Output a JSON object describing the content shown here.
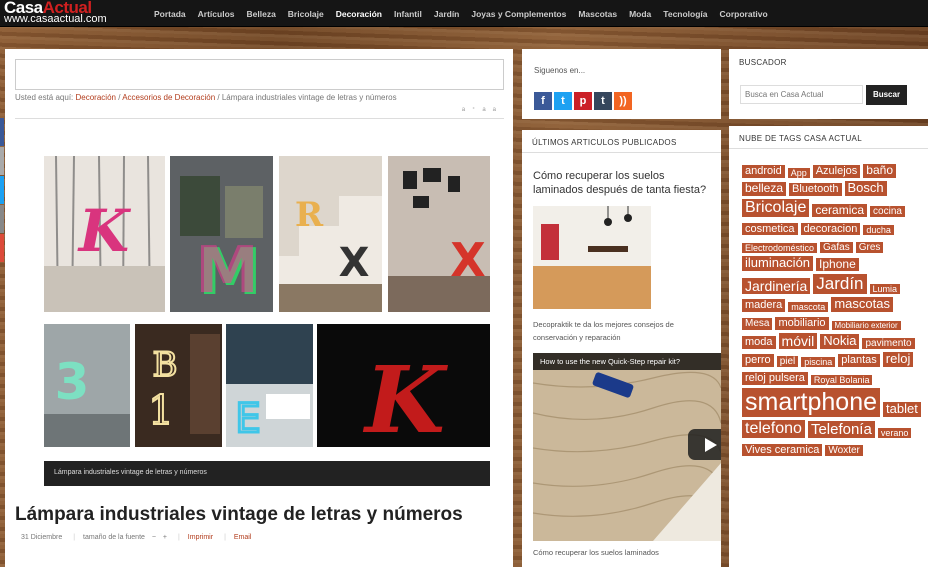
{
  "site": {
    "logo_word1": "Casa",
    "logo_word2": "Actual",
    "logo_domain": "www.casaactual.com"
  },
  "nav": [
    "Portada",
    "Artículos",
    "Belleza",
    "Bricolaje",
    "Decoración",
    "Infantil",
    "Jardín",
    "Joyas y Complementos",
    "Mascotas",
    "Moda",
    "Tecnología",
    "Corporativo"
  ],
  "nav_active": "Decoración",
  "breadcrumb": {
    "prefix": "Usted está aquí:",
    "link1": "Decoración",
    "sep1": " / ",
    "link2": "Accesorios de Decoración",
    "sep2": " / ",
    "current": "Lámpara industriales vintage de letras y números"
  },
  "article": {
    "caption": "Lámpara industriales vintage de letras y números",
    "title": "Lámpara industriales vintage de letras y números",
    "date": "31 Diciembre",
    "font_label": "tamaño de la fuente",
    "font_minus": "−",
    "font_plus": "+",
    "print": "Imprimir",
    "email": "Email"
  },
  "follow": {
    "title": "Siguenos en...",
    "icons": [
      "facebook-icon",
      "twitter-icon",
      "pinterest-icon",
      "tumblr-icon",
      "rss-icon"
    ],
    "colors": [
      "#3b5998",
      "#1da1f2",
      "#cb2027",
      "#35465c",
      "#f26522"
    ]
  },
  "latest": {
    "title": "ÚLTIMOS ARTICULOS PUBLICADOS",
    "post_title": "Cómo recuperar los suelos laminados después de tanta fiesta?",
    "post_desc": "Decopraktik te da los mejores consejos de conservación y reparación",
    "video_title": "How to use the new Quick-Step repair kit?",
    "video_caption": "Cómo recuperar los suelos laminados"
  },
  "search": {
    "title": "BUSCADOR",
    "placeholder": "Busca en Casa Actual",
    "button": "Buscar"
  },
  "tags": {
    "title": "NUBE DE TAGS CASA ACTUAL",
    "items": [
      {
        "t": "android",
        "s": 11
      },
      {
        "t": "App",
        "s": 9
      },
      {
        "t": "Azulejos",
        "s": 11
      },
      {
        "t": "baño",
        "s": 12
      },
      {
        "t": "belleza",
        "s": 12
      },
      {
        "t": "Bluetooth",
        "s": 11
      },
      {
        "t": "Bosch",
        "s": 13
      },
      {
        "t": "Bricolaje",
        "s": 16
      },
      {
        "t": "ceramica",
        "s": 12
      },
      {
        "t": "cocina",
        "s": 10
      },
      {
        "t": "cosmetica",
        "s": 11
      },
      {
        "t": "decoracion",
        "s": 11
      },
      {
        "t": "ducha",
        "s": 9
      },
      {
        "t": "Electrodoméstico",
        "s": 9
      },
      {
        "t": "Gafas",
        "s": 10
      },
      {
        "t": "Gres",
        "s": 10
      },
      {
        "t": "iluminación",
        "s": 13
      },
      {
        "t": "Iphone",
        "s": 12
      },
      {
        "t": "Jardinería",
        "s": 14
      },
      {
        "t": "Jardín",
        "s": 17
      },
      {
        "t": "Lumia",
        "s": 9
      },
      {
        "t": "madera",
        "s": 11
      },
      {
        "t": "mascota",
        "s": 9
      },
      {
        "t": "mascotas",
        "s": 13
      },
      {
        "t": "Mesa",
        "s": 10
      },
      {
        "t": "mobiliario",
        "s": 11
      },
      {
        "t": "Mobiliario exterior",
        "s": 8
      },
      {
        "t": "moda",
        "s": 11
      },
      {
        "t": "móvil",
        "s": 14
      },
      {
        "t": "Nokia",
        "s": 13
      },
      {
        "t": "pavimento",
        "s": 10
      },
      {
        "t": "perro",
        "s": 11
      },
      {
        "t": "piel",
        "s": 10
      },
      {
        "t": "piscina",
        "s": 9
      },
      {
        "t": "plantas",
        "s": 11
      },
      {
        "t": "reloj",
        "s": 13
      },
      {
        "t": "reloj pulsera",
        "s": 11
      },
      {
        "t": "Royal Bolania",
        "s": 9
      },
      {
        "t": "smartphone",
        "s": 25
      },
      {
        "t": "tablet",
        "s": 13
      },
      {
        "t": "telefono",
        "s": 16
      },
      {
        "t": "Telefonía",
        "s": 15
      },
      {
        "t": "verano",
        "s": 9
      },
      {
        "t": "Vives ceramica",
        "s": 11
      },
      {
        "t": "Woxter",
        "s": 10
      }
    ]
  },
  "colors": {
    "accent": "#b8522f",
    "link": "#b23c1c",
    "topbar": "#151515"
  }
}
